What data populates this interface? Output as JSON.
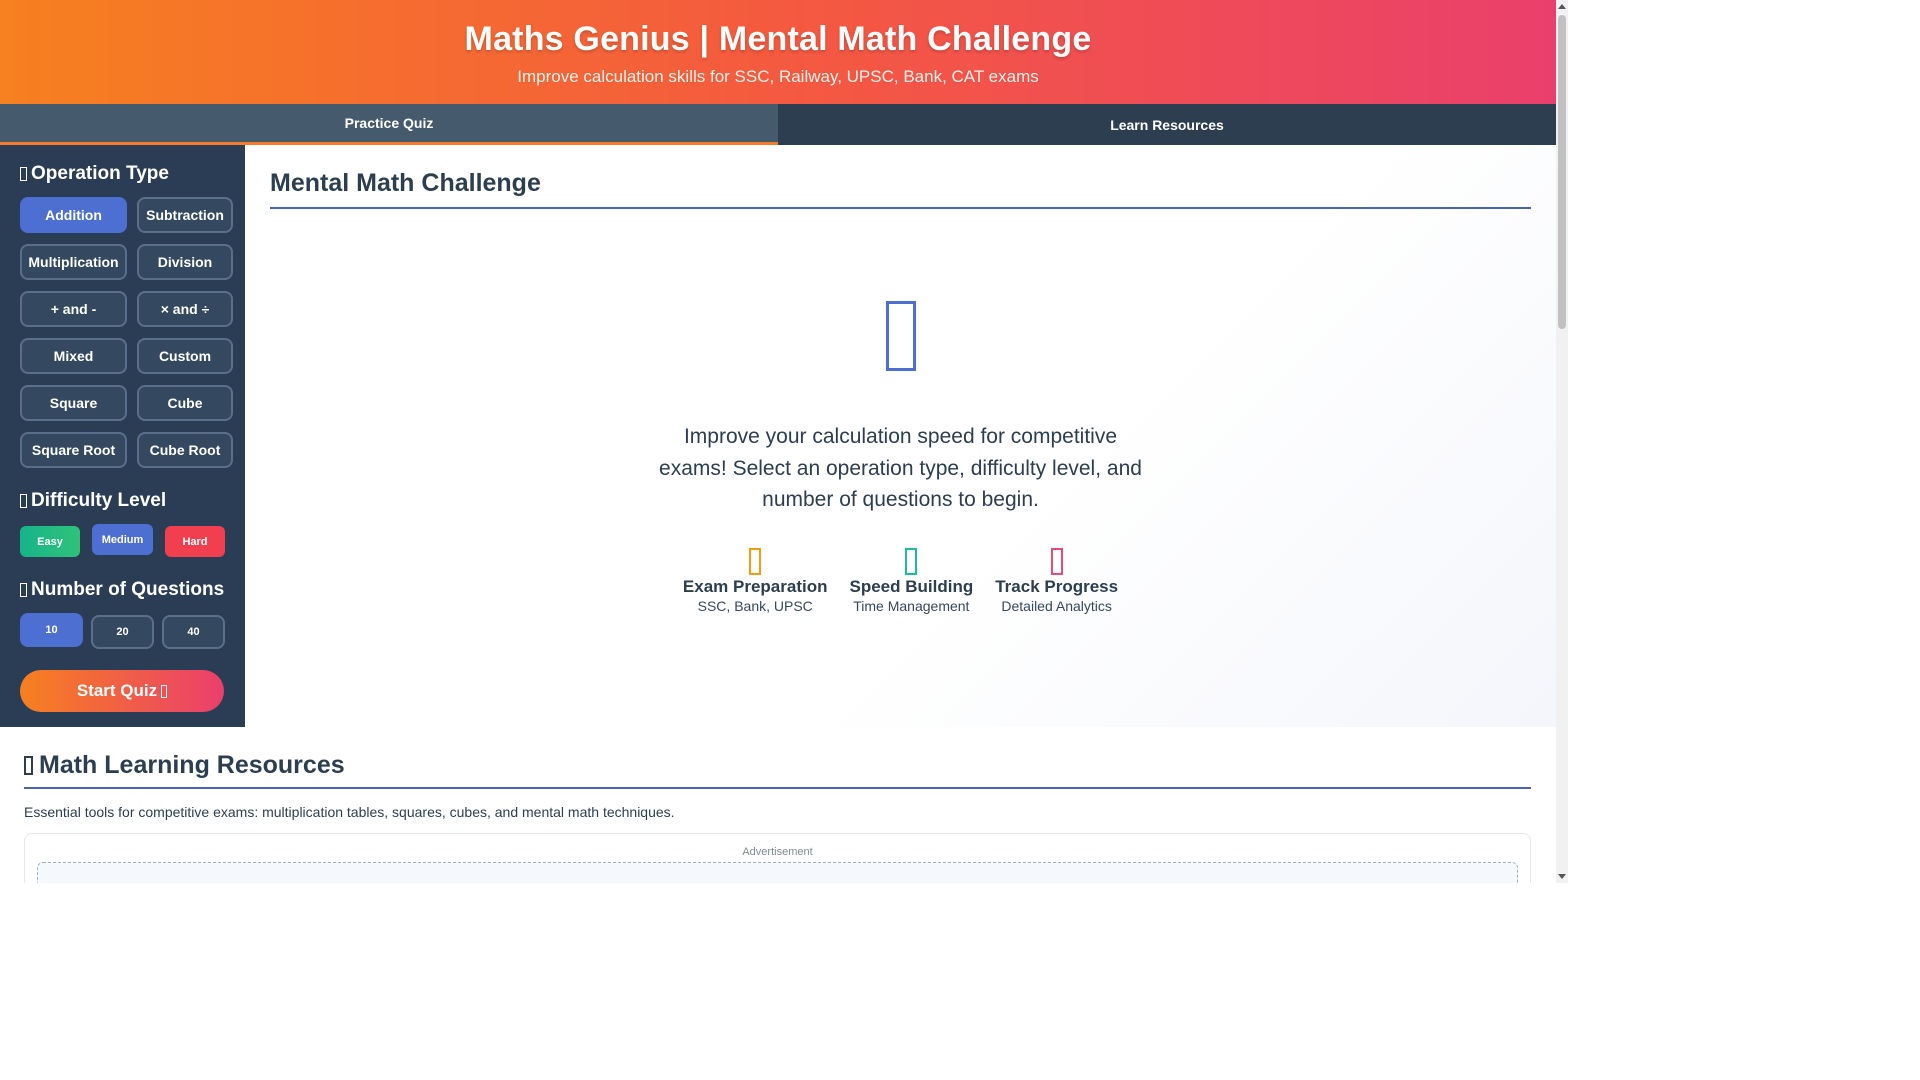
{
  "header": {
    "title": " Maths Genius | Mental Math Challenge",
    "subtitle": "Improve calculation skills for SSC, Railway, UPSC, Bank, CAT exams"
  },
  "tabs": [
    {
      "label": "Practice Quiz"
    },
    {
      "label": "Learn Resources"
    }
  ],
  "sidebar": {
    "operation_title": "Operation Type",
    "operations": [
      {
        "label": "Addition"
      },
      {
        "label": "Subtraction"
      },
      {
        "label": "Multiplication"
      },
      {
        "label": "Division"
      },
      {
        "label": "+ and -"
      },
      {
        "label": "× and ÷"
      },
      {
        "label": "Mixed"
      },
      {
        "label": "Custom"
      },
      {
        "label": "Square"
      },
      {
        "label": "Cube"
      },
      {
        "label": "Square Root"
      },
      {
        "label": "Cube Root"
      }
    ],
    "difficulty_title": "Difficulty Level",
    "difficulty": {
      "easy": "Easy",
      "medium": "Medium",
      "hard": "Hard"
    },
    "questions_title": "Number of Questions",
    "questions": [
      "10",
      "20",
      "40"
    ],
    "start_label": "Start Quiz"
  },
  "main": {
    "title": "Mental Math Challenge",
    "intro": "Improve your calculation speed for competitive exams! Select an operation type, difficulty level, and number of questions to begin.",
    "features": [
      {
        "name": "Exam Preparation",
        "desc": "SSC, Bank, UPSC",
        "color": "#f39c12"
      },
      {
        "name": "Speed Building",
        "desc": "Time Management",
        "color": "#1abc9c"
      },
      {
        "name": "Track Progress",
        "desc": "Detailed Analytics",
        "color": "#e84a7a"
      }
    ]
  },
  "resources": {
    "title": "Math Learning Resources",
    "desc": "Essential tools for competitive exams: multiplication tables, squares, cubes, and mental math techniques.",
    "ad_label": "Advertisement"
  },
  "colors": {
    "accent": "#4d6fd1",
    "sidebar_bg": "#2b3d55",
    "header_start": "#f7801f",
    "header_end": "#ea3f6c"
  }
}
